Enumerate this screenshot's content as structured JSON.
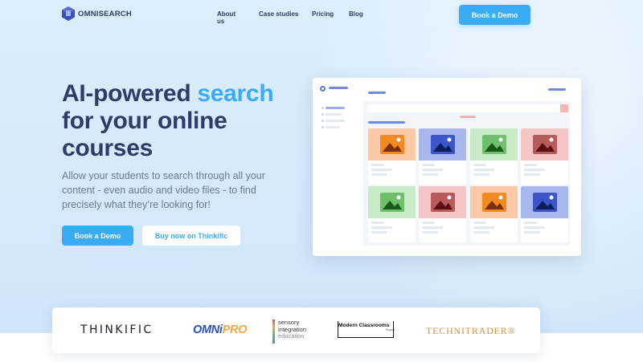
{
  "brand": {
    "name": "OMNISEARCH"
  },
  "nav": {
    "items": [
      "About us",
      "Case studies",
      "Pricing",
      "Blog"
    ],
    "cta": "Book a Demo"
  },
  "hero": {
    "title_part1": "AI-powered",
    "title_accent": "search",
    "title_part2": "for your online courses",
    "subtitle": "Allow your students to search through all your content - even audio and video files - to find precisely what they’re looking for!",
    "primary_cta": "Book a Demo",
    "secondary_cta": "Buy now on Thinkific"
  },
  "mockup": {
    "cards": [
      {
        "bg": "#fbc9a6",
        "tile": "#f28a1f",
        "mountain": "#7a2e0c"
      },
      {
        "bg": "#a9b7ef",
        "tile": "#3b56cc",
        "mountain": "#101d5a"
      },
      {
        "bg": "#c8eac5",
        "tile": "#6cc16a",
        "mountain": "#19561a"
      },
      {
        "bg": "#f6c6c6",
        "tile": "#b95b5b",
        "mountain": "#5a1010"
      },
      {
        "bg": "#c8eac5",
        "tile": "#6cc16a",
        "mountain": "#19561a"
      },
      {
        "bg": "#f6c6c6",
        "tile": "#b95b5b",
        "mountain": "#5a1010"
      },
      {
        "bg": "#fbc9a6",
        "tile": "#f28a1f",
        "mountain": "#7a2e0c"
      },
      {
        "bg": "#a9b7ef",
        "tile": "#3b56cc",
        "mountain": "#101d5a"
      }
    ]
  },
  "partners": {
    "thinkific": "THINKIFIC",
    "omnipro_a": "OMNi",
    "omnipro_b": "PRO",
    "sensory_1": "sensory",
    "sensory_2": "integration",
    "sensory_3": "education",
    "mcp_title": "Modern Classrooms",
    "mcp_sub": "Project",
    "technitrader": "TECHNITRADER®"
  },
  "colors": {
    "accent": "#3aacf6",
    "heading": "#2d3c69",
    "body_text": "#6b7a93"
  }
}
